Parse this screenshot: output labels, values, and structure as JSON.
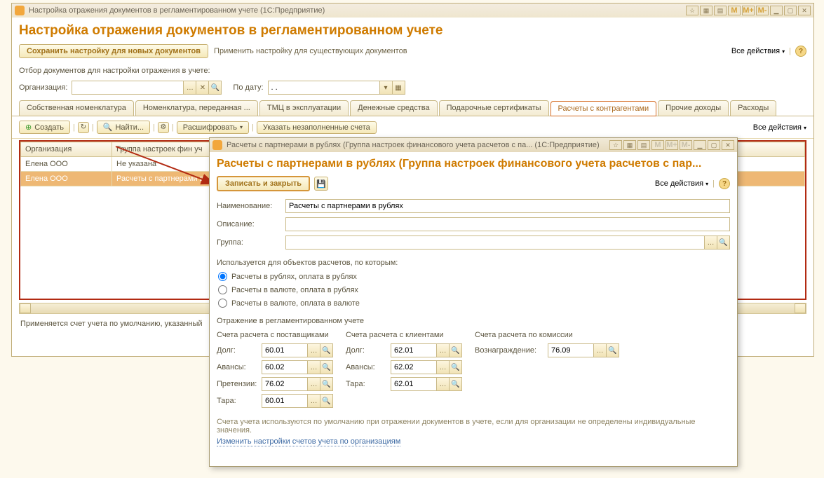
{
  "main": {
    "title": "Настройка отражения документов в регламентированном учете  (1С:Предприятие)",
    "heading": "Настройка отражения документов в регламентированном учете",
    "saveTemplateBtn": "Сохранить настройку для новых документов",
    "applyLink": "Применить настройку для существующих документов",
    "allActions": "Все действия",
    "filterLabel": "Отбор документов для настройки отражения в учете:",
    "orgLabel": "Организация:",
    "dateLabel": "По дату:",
    "dateValue": ". .",
    "tabs": [
      "Собственная номенклатура",
      "Номенклатура, переданная ...",
      "ТМЦ в эксплуатации",
      "Денежные средства",
      "Подарочные сертификаты",
      "Расчеты с контрагентами",
      "Прочие доходы",
      "Расходы"
    ],
    "createBtn": "Создать",
    "findBtn": "Найти...",
    "decryptBtn": "Расшифровать",
    "specifyBtn": "Указать незаполненные счета",
    "gridHeaders": [
      "Организация",
      "Группа настроек фин уч"
    ],
    "rows": [
      {
        "org": "Елена ООО",
        "group": "Не указана",
        "faded": true
      },
      {
        "org": "Елена ООО",
        "group": "Расчеты с партнерами в",
        "faded": false,
        "selected": true
      }
    ],
    "status": "Применяется счет учета по умолчанию, указанный"
  },
  "dialog": {
    "title": "Расчеты с партнерами в рублях (Группа настроек финансового учета расчетов с па...  (1С:Предприятие)",
    "heading": "Расчеты с партнерами в рублях (Группа настроек финансового учета расчетов с пар...",
    "saveBtn": "Записать и закрыть",
    "allActions": "Все действия",
    "nameLabel": "Наименование:",
    "nameValue": "Расчеты с партнерами в рублях",
    "descLabel": "Описание:",
    "groupLabel": "Группа:",
    "usageLabel": "Используется для объектов расчетов, по которым:",
    "radios": [
      "Расчеты в рублях, оплата в рублях",
      "Расчеты в валюте, оплата в рублях",
      "Расчеты в валюте, оплата в валюте"
    ],
    "reflectionLabel": "Отражение в регламентированном учете",
    "colSuppliers": "Счета расчета с поставщиками",
    "colClients": "Счета расчета с клиентами",
    "colCommission": "Счета расчета по комиссии",
    "debtLabel": "Долг:",
    "advanceLabel": "Авансы:",
    "claimsLabel": "Претензии:",
    "taraLabel": "Тара:",
    "rewardLabel": "Вознаграждение:",
    "suppliers": {
      "debt": "60.01",
      "advance": "60.02",
      "claims": "76.02",
      "tara": "60.01"
    },
    "clients": {
      "debt": "62.01",
      "advance": "62.02",
      "tara": "62.01"
    },
    "commission": {
      "reward": "76.09"
    },
    "hint": "Счета учета используются по умолчанию при отражении документов в учете, если для организации не определены индивидуальные значения.",
    "link": "Изменить настройки счетов учета по организациям"
  }
}
